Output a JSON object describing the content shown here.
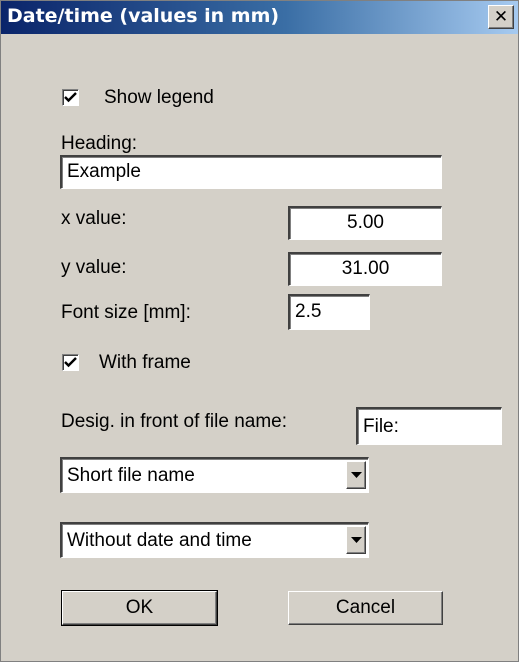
{
  "window": {
    "title": "Date/time (values in mm)",
    "close_icon": "close-icon"
  },
  "show_legend": {
    "label": "Show legend",
    "checked": true
  },
  "heading": {
    "label": "Heading:",
    "value": "Example"
  },
  "x_value": {
    "label": "x value:",
    "value": "5.00"
  },
  "y_value": {
    "label": "y value:",
    "value": "31.00"
  },
  "font_size": {
    "label": "Font size [mm]:",
    "value": "2.5"
  },
  "with_frame": {
    "label": "With frame",
    "checked": true
  },
  "designation": {
    "label": "Desig. in front of file name:",
    "value": "File:"
  },
  "file_name_select": {
    "selected": "Short file name"
  },
  "date_time_select": {
    "selected": "Without date and time"
  },
  "buttons": {
    "ok": "OK",
    "cancel": "Cancel"
  },
  "colors": {
    "title_start": "#0a246a",
    "title_end": "#a6caf0",
    "face": "#d4d0c8"
  }
}
